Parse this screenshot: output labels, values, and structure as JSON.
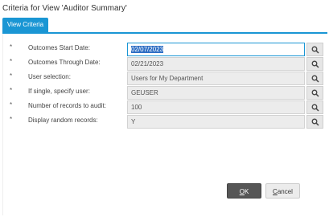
{
  "window": {
    "title": "Criteria for View 'Auditor Summary'"
  },
  "tabs": [
    {
      "label": "View Criteria",
      "active": true
    }
  ],
  "criteria": {
    "required_marker": "*",
    "fields": [
      {
        "label": "Outcomes Start Date:",
        "value": "02/07/2023",
        "focused": true
      },
      {
        "label": "Outcomes Through Date:",
        "value": "02/21/2023"
      },
      {
        "label": "User selection:",
        "value": "Users for My Department"
      },
      {
        "label": "If single, specify user:",
        "value": "GEUSER"
      },
      {
        "label": "Number of records to audit:",
        "value": "100"
      },
      {
        "label": "Display random records:",
        "value": "Y"
      }
    ],
    "lookup_icon": "search-icon"
  },
  "buttons": {
    "ok_mnemonic": "O",
    "ok_rest": "K",
    "cancel_mnemonic": "C",
    "cancel_rest": "ancel"
  },
  "colors": {
    "accent": "#1a96d4",
    "selection": "#2f6fc4",
    "field_bg": "#ececec",
    "ok_button": "#565656"
  }
}
